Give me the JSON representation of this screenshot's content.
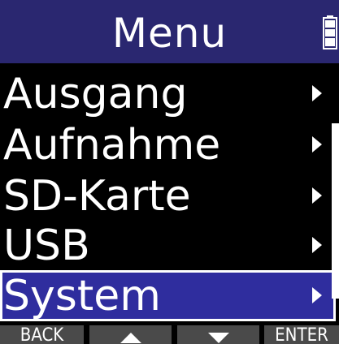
{
  "header": {
    "title": "Menu",
    "battery_icon": "battery-icon"
  },
  "menu": {
    "items": [
      {
        "label": "Ausgang",
        "icon": "chevron-right-icon",
        "selected": false
      },
      {
        "label": "Aufnahme",
        "icon": "chevron-right-icon",
        "selected": false
      },
      {
        "label": "SD-Karte",
        "icon": "chevron-right-icon",
        "selected": false
      },
      {
        "label": "USB",
        "icon": "chevron-right-icon",
        "selected": false
      },
      {
        "label": "System",
        "icon": "chevron-right-icon",
        "selected": true
      }
    ]
  },
  "footer": {
    "back_label": "BACK",
    "up_icon": "triangle-up-icon",
    "down_icon": "triangle-down-icon",
    "enter_label": "ENTER"
  },
  "colors": {
    "header_bg": "#2a2770",
    "selected_bg": "#2f2d9e",
    "footer_btn_bg": "#4a4a4a",
    "text": "#ffffff",
    "background": "#000000"
  }
}
